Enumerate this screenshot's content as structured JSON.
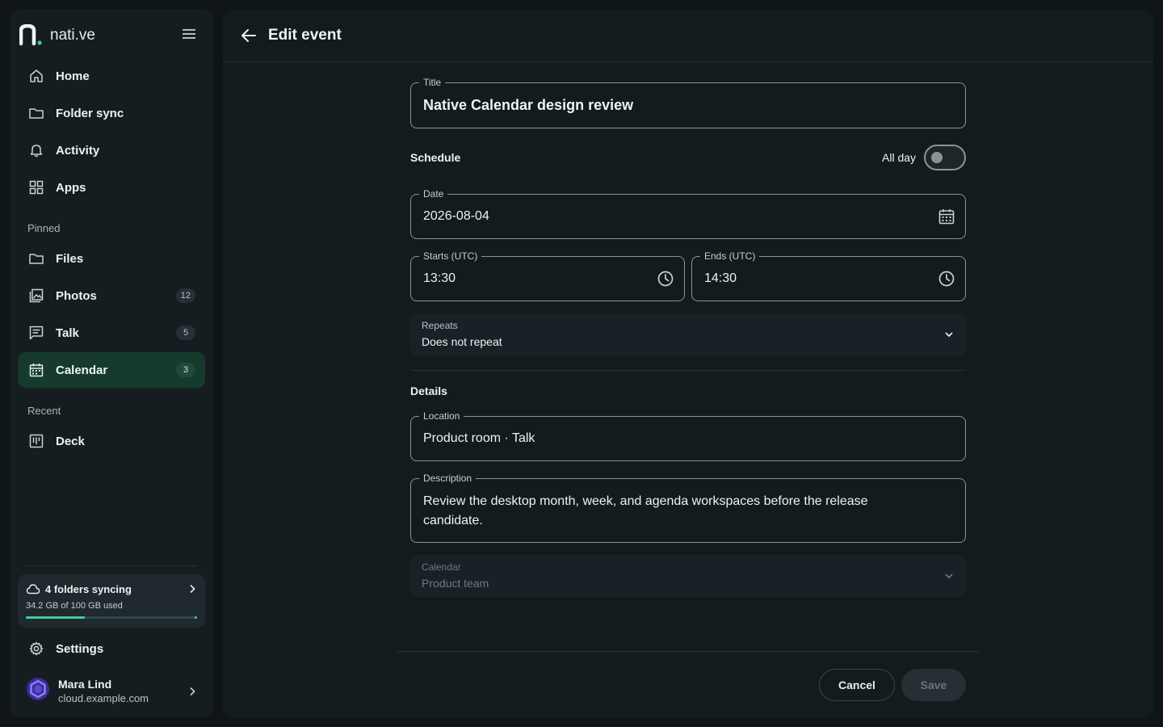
{
  "app": {
    "name": "nati.ve",
    "accent": "#3fcf95",
    "active_bg": "#163b2d"
  },
  "sidebar": {
    "main_items": [
      {
        "label": "Home",
        "icon": "home-icon"
      },
      {
        "label": "Folder sync",
        "icon": "folder-icon"
      },
      {
        "label": "Activity",
        "icon": "bell-icon"
      },
      {
        "label": "Apps",
        "icon": "grid-icon"
      }
    ],
    "pinned_label": "Pinned",
    "pinned_items": [
      {
        "label": "Files",
        "icon": "folder-icon",
        "badge": ""
      },
      {
        "label": "Photos",
        "icon": "photos-icon",
        "badge": "12"
      },
      {
        "label": "Talk",
        "icon": "chat-icon",
        "badge": "5"
      },
      {
        "label": "Calendar",
        "icon": "calendar-icon",
        "badge": "3",
        "active": true
      }
    ],
    "recent_label": "Recent",
    "recent_items": [
      {
        "label": "Deck",
        "icon": "deck-icon"
      }
    ],
    "sync": {
      "title": "4 folders syncing",
      "usage": "34.2 GB of 100 GB used",
      "used_fraction": 0.342
    },
    "settings_label": "Settings",
    "user": {
      "name": "Mara Lind",
      "host": "cloud.example.com"
    }
  },
  "header": {
    "title": "Edit event"
  },
  "form": {
    "title_label": "Title",
    "title_value": "Native Calendar design review",
    "schedule_heading": "Schedule",
    "allday_label": "All day",
    "allday_on": false,
    "date_label": "Date",
    "date_value": "2026-08-04",
    "start_label": "Starts (UTC)",
    "start_value": "13:30",
    "end_label": "Ends (UTC)",
    "end_value": "14:30",
    "repeats_label": "Repeats",
    "repeats_value": "Does not repeat",
    "details_heading": "Details",
    "location_label": "Location",
    "location_value": "Product room · Talk",
    "description_label": "Description",
    "description_line1": "Review the desktop month, week, and agenda workspaces before the release",
    "description_line2": "candidate.",
    "calendar_label": "Calendar",
    "calendar_value": "Product team"
  },
  "actions": {
    "cancel": "Cancel",
    "save": "Save"
  }
}
